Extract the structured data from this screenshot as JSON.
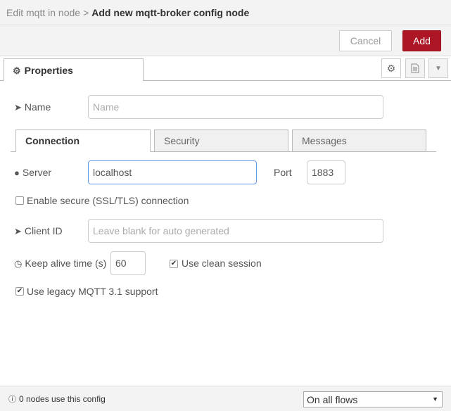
{
  "breadcrumb": {
    "parent": "Edit mqtt in node",
    "separator": ">",
    "current": "Add new mqtt-broker config node"
  },
  "actions": {
    "cancel_label": "Cancel",
    "add_label": "Add"
  },
  "tabs": {
    "properties_label": "Properties"
  },
  "form": {
    "name": {
      "label": "Name",
      "placeholder": "Name",
      "value": ""
    },
    "subtabs": [
      "Connection",
      "Security",
      "Messages"
    ],
    "active_subtab": "Connection",
    "server": {
      "label": "Server",
      "value": "localhost"
    },
    "port": {
      "label": "Port",
      "value": "1883"
    },
    "ssl": {
      "label": "Enable secure (SSL/TLS) connection",
      "checked": false
    },
    "client_id": {
      "label": "Client ID",
      "placeholder": "Leave blank for auto generated",
      "value": ""
    },
    "keep_alive": {
      "label": "Keep alive time (s)",
      "value": "60"
    },
    "clean_session": {
      "label": "Use clean session",
      "checked": true
    },
    "legacy": {
      "label": "Use legacy MQTT 3.1 support",
      "checked": true
    }
  },
  "footer": {
    "info_text": "0 nodes use this config",
    "scope_selected": "On all flows"
  },
  "colors": {
    "accent": "#ad1625",
    "focus_border": "#6495ed"
  }
}
